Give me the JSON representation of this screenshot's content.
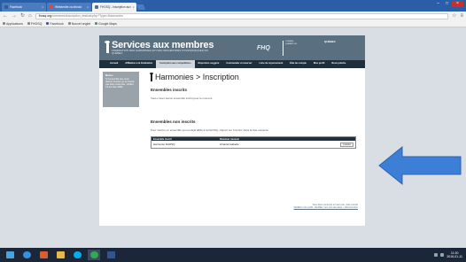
{
  "browser": {
    "tabs": [
      {
        "label": "Facebook",
        "active": false,
        "color": "#3b5998"
      },
      {
        "label": "Wetransfer.ca dézout",
        "active": false,
        "color": "#e0483b"
      },
      {
        "label": "FHOSQ - Inscription aux",
        "active": true,
        "color": "#5a6f80"
      }
    ],
    "url_domain": "fhosq.org",
    "url_path": "/membres/inscription_festival.php?Type=Harmonies",
    "bookmarks": [
      {
        "label": "Applications",
        "icon": "grid-icon"
      },
      {
        "label": "FHOSQ",
        "icon": "page-icon"
      },
      {
        "label": "Facebook",
        "icon": "facebook-icon"
      },
      {
        "label": "Nouvel onglet",
        "icon": "page-icon"
      },
      {
        "label": "Google Maps",
        "icon": "maps-icon"
      }
    ]
  },
  "site": {
    "title": "Services aux membres",
    "subtitle": "FÉDÉRATION DES HARMONIES ET DES ORCHESTRES SYMPHONIQUES DU QUÉBEC",
    "fhosq_logo": "FHQ",
    "partner_logo": "CONSEIL QUÉBÉCOIS",
    "quebec_logo": "QUÉBEC",
    "nav": [
      {
        "label": "Accueil",
        "active": false
      },
      {
        "label": "Affiliation à la Fédération",
        "active": false
      },
      {
        "label": "Inscription aux compétitions",
        "active": true
      },
      {
        "label": "Répertoire suggéré",
        "active": false
      },
      {
        "label": "Commander et réserver",
        "active": false
      },
      {
        "label": "Liste de rayonnement",
        "active": false
      },
      {
        "label": "État de compte",
        "active": false
      },
      {
        "label": "Mon profil",
        "active": false
      },
      {
        "label": "Nous joindre",
        "active": false
      }
    ],
    "sidebar": {
      "heading": "Mentor",
      "text": "Si l'ensemble que vous désirez inscrire ne se trouve pas dans cette liste, vérifiez s'il est bien affilié."
    },
    "page_title": "Harmonies  > Inscription",
    "section1": {
      "heading": "Ensembles inscrits",
      "text": "Vous n'avez aucun ensemble inscrit pour le moment."
    },
    "section2": {
      "heading": "Ensembles non inscrits",
      "text": "Pour inscrire un ensemble qui est déjà affilié à la FHOSQ, cliquez sur 'Inscrire' dans la liste suivante."
    },
    "table": {
      "headers": [
        "Ensemble inscrit",
        "Directeur musical"
      ],
      "rows": [
        {
          "ensemble": "Harmonie FHOSQ",
          "director": "Chantal Isabelle",
          "action": "Inscrire"
        }
      ]
    },
    "footer": {
      "line1": "Vous êtes connecté en tant que: Julie Lavoie",
      "line2": "Modifier mon profil - Modifier mon mot de passe - Déconnexion"
    }
  },
  "annotation": {
    "arrow_color": "#3d7fd6"
  },
  "taskbar": {
    "apps": [
      {
        "icon": "windows-start-icon",
        "color": "#4aa3df"
      },
      {
        "icon": "ie-icon",
        "color": "#3b8fd9"
      },
      {
        "icon": "media-icon",
        "color": "#e05a2c"
      },
      {
        "icon": "explorer-icon",
        "color": "#e8b84a"
      },
      {
        "icon": "skype-icon",
        "color": "#00aff0"
      },
      {
        "icon": "chrome-icon",
        "color": "#34a853"
      },
      {
        "icon": "word-icon",
        "color": "#2b5797"
      }
    ],
    "time": "11:30",
    "date": "2016-01-11"
  }
}
